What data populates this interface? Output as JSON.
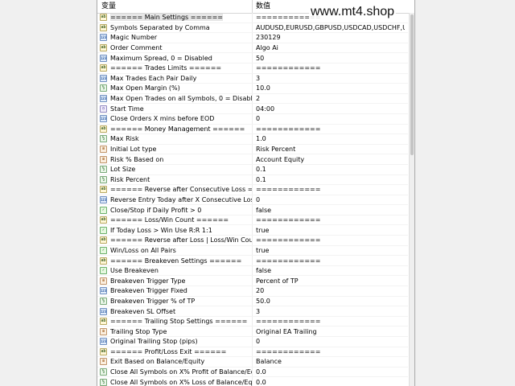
{
  "header": {
    "variable": "变量",
    "value": "数值"
  },
  "watermark": "www.mt4.shop",
  "rows": [
    {
      "icon": "ab",
      "name": "====== Main Settings ======",
      "value": "============"
    },
    {
      "icon": "ab",
      "name": "Symbols Separated by Comma",
      "value": "AUDUSD,EURUSD,GBPUSD,USDCAD,USDCHF,USDJP..."
    },
    {
      "icon": "num",
      "name": "Magic Number",
      "value": "230129"
    },
    {
      "icon": "ab",
      "name": "Order Comment",
      "value": "Algo Ai"
    },
    {
      "icon": "num",
      "name": "Maximum Spread, 0 = Disabled",
      "value": "50"
    },
    {
      "icon": "ab",
      "name": "====== Trades Limits ======",
      "value": "============"
    },
    {
      "icon": "num",
      "name": "Max Trades Each Pair Daily",
      "value": "3"
    },
    {
      "icon": "dbl",
      "name": "Max Open Margin (%)",
      "value": "10.0"
    },
    {
      "icon": "num",
      "name": "Max Open Trades on all Symbols, 0 = Disable",
      "value": "2"
    },
    {
      "icon": "time",
      "name": "Start Time",
      "value": "04:00"
    },
    {
      "icon": "num",
      "name": "Close Orders X mins before EOD",
      "value": "0"
    },
    {
      "icon": "ab",
      "name": "====== Money Management ======",
      "value": "============"
    },
    {
      "icon": "dbl",
      "name": "Max Risk",
      "value": "1.0"
    },
    {
      "icon": "lst",
      "name": "Initial Lot type",
      "value": "Risk Percent"
    },
    {
      "icon": "lst",
      "name": "Risk % Based on",
      "value": "Account Equity"
    },
    {
      "icon": "dbl",
      "name": "Lot Size",
      "value": "0.1"
    },
    {
      "icon": "dbl",
      "name": "Risk Percent",
      "value": "0.1"
    },
    {
      "icon": "ab",
      "name": "====== Reverse after Consecutive Loss ===...",
      "value": "============"
    },
    {
      "icon": "num",
      "name": "Reverse Entry Today after X Consecutive Loss, R...",
      "value": "0"
    },
    {
      "icon": "bool",
      "name": "Close/Stop if Daily Profit > 0",
      "value": "false"
    },
    {
      "icon": "ab",
      "name": "====== Loss/Win Count ======",
      "value": "============"
    },
    {
      "icon": "bool",
      "name": "If Today Loss > Win Use R:R 1:1",
      "value": "true"
    },
    {
      "icon": "ab",
      "name": "====== Reverse after Loss | Loss/Win Count =...",
      "value": "============"
    },
    {
      "icon": "bool",
      "name": "Win/Loss on All Pairs",
      "value": "true"
    },
    {
      "icon": "ab",
      "name": "====== Breakeven Settings ======",
      "value": "============"
    },
    {
      "icon": "bool",
      "name": "Use Breakeven",
      "value": "false"
    },
    {
      "icon": "lst",
      "name": "Breakeven Trigger Type",
      "value": "Percent of TP"
    },
    {
      "icon": "num",
      "name": "Breakeven Trigger Fixed",
      "value": "20"
    },
    {
      "icon": "dbl",
      "name": "Breakeven Trigger % of TP",
      "value": "50.0"
    },
    {
      "icon": "num",
      "name": "Breakeven SL Offset",
      "value": "3"
    },
    {
      "icon": "ab",
      "name": "====== Trailing Stop Settings ======",
      "value": "============"
    },
    {
      "icon": "lst",
      "name": "Trailing Stop Type",
      "value": "Original EA Trailing"
    },
    {
      "icon": "num",
      "name": "Original Trailing Stop (pips)",
      "value": "0"
    },
    {
      "icon": "ab",
      "name": "====== Profit/Loss Exit ======",
      "value": "============"
    },
    {
      "icon": "lst",
      "name": "Exit Based on Balance/Equity",
      "value": "Balance"
    },
    {
      "icon": "dbl",
      "name": "Close All Symbols on X% Profit of Balance/Equity",
      "value": "0.0"
    },
    {
      "icon": "dbl",
      "name": "Close All Symbols on X% Loss of Balance/Equity",
      "value": "0.0"
    }
  ]
}
